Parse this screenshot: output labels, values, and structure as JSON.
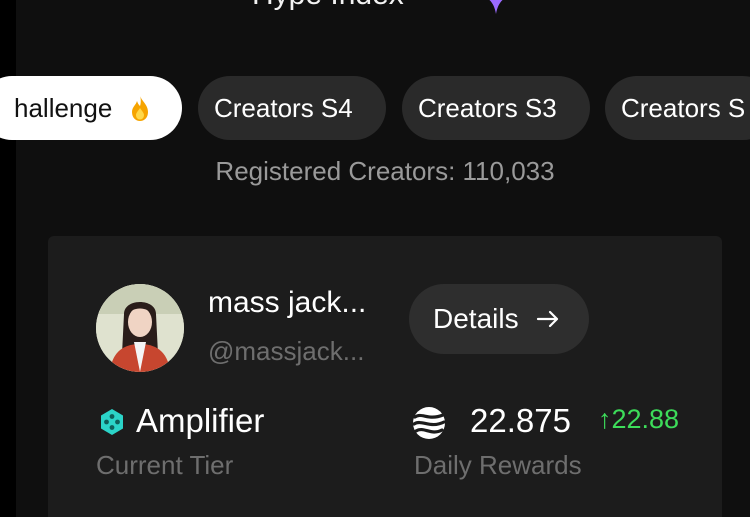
{
  "header": {
    "title": "Hype Index",
    "accent_color": "#9b6bff"
  },
  "tabs": [
    {
      "label": "hallenge",
      "active": true,
      "icon": "flame-icon"
    },
    {
      "label": "Creators S4",
      "active": false
    },
    {
      "label": "Creators S3",
      "active": false
    },
    {
      "label": "Creators S",
      "active": false
    }
  ],
  "registered_creators": "Registered Creators: 110,033",
  "card": {
    "name": "mass jack...",
    "handle": "@massjack...",
    "details_label": "Details",
    "tier": {
      "value": "Amplifier",
      "label": "Current Tier",
      "icon_color": "#2bd4c8"
    },
    "rewards": {
      "value": "22.875",
      "change": "↑22.88",
      "change_color": "#3ddc5a",
      "label": "Daily Rewards"
    }
  }
}
